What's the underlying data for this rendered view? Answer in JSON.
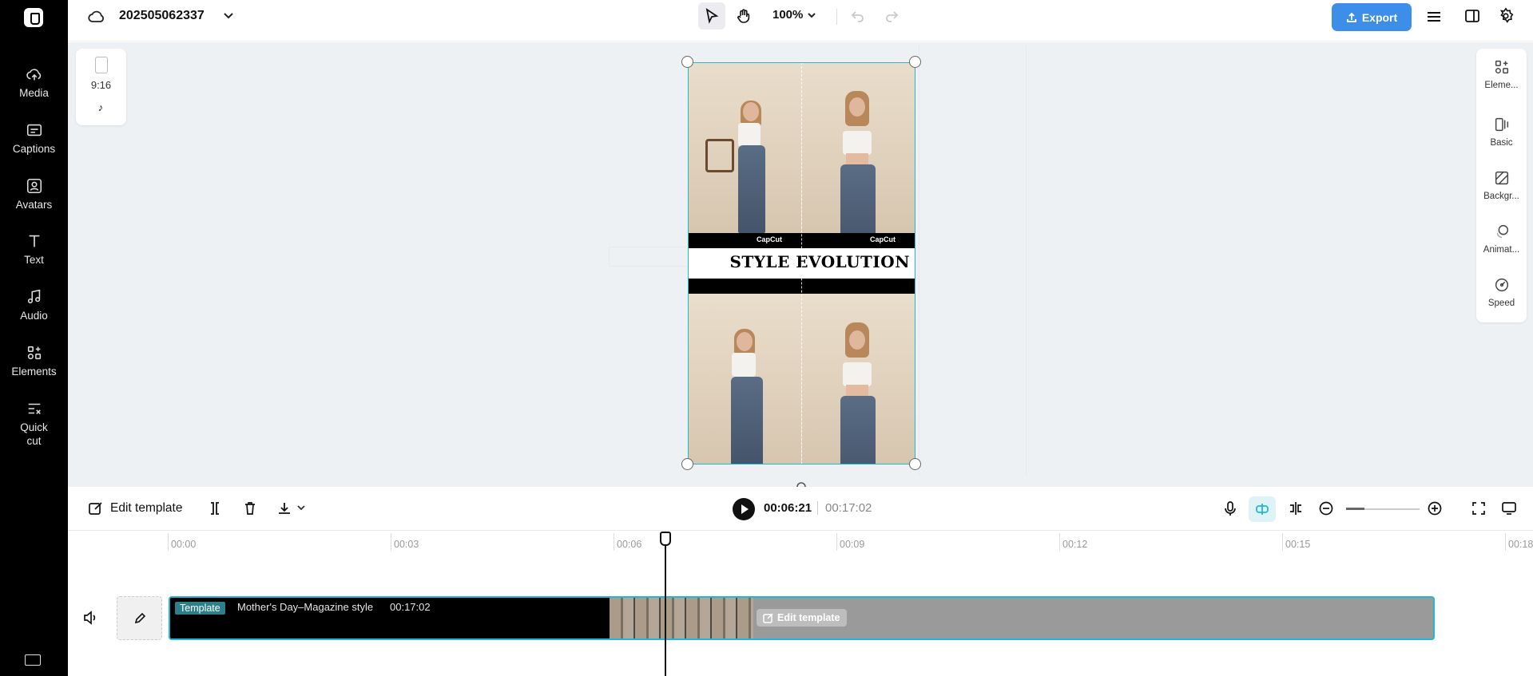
{
  "app": {
    "project_name": "202505062337",
    "zoom": "100%",
    "export_label": "Export",
    "accent_color": "#23b7d1",
    "export_color": "#3c8ee8"
  },
  "left_nav": {
    "items": [
      {
        "label": "Media",
        "icon": "upload-cloud-icon"
      },
      {
        "label": "Captions",
        "icon": "captions-icon"
      },
      {
        "label": "Avatars",
        "icon": "avatar-icon"
      },
      {
        "label": "Text",
        "icon": "text-icon"
      },
      {
        "label": "Audio",
        "icon": "music-note-icon"
      },
      {
        "label": "Elements",
        "icon": "elements-grid-icon"
      },
      {
        "label": "Quick cut",
        "icon": "quick-cut-icon"
      }
    ]
  },
  "canvas": {
    "aspect_ratio": "9:16",
    "platform_icon": "tiktok-icon",
    "title_text": "STYLE EVOLUTION",
    "watermark": "CapCut"
  },
  "right_panel": {
    "items": [
      {
        "label": "Eleme...",
        "icon": "elements-icon"
      },
      {
        "label": "Basic",
        "icon": "basic-icon"
      },
      {
        "label": "Backgr...",
        "icon": "background-icon"
      },
      {
        "label": "Animat...",
        "icon": "animation-icon"
      },
      {
        "label": "Speed",
        "icon": "speed-icon"
      }
    ]
  },
  "toolbar": {
    "edit_template_label": "Edit template",
    "current_time": "00:06:21",
    "total_time": "00:17:02",
    "zoom_level": 0.25
  },
  "timeline": {
    "ruler": [
      "00:00",
      "00:03",
      "00:06",
      "00:09",
      "00:12",
      "00:15",
      "00:18"
    ],
    "clip": {
      "badge": "Template",
      "name": "Mother's Day–Magazine style",
      "duration": "00:17:02",
      "edit_label": "Edit template"
    }
  }
}
